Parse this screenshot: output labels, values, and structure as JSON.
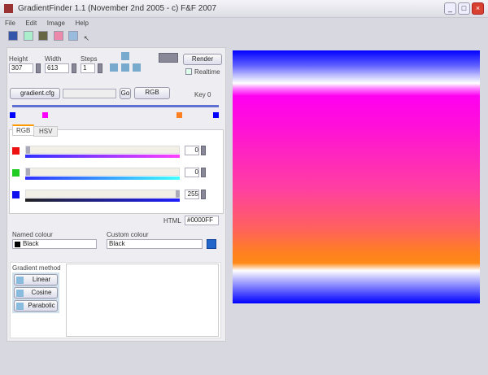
{
  "window": {
    "title": "GradientFinder 1.1 (November 2nd 2005 - c) F&F 2007",
    "minimize": "_",
    "maximize": "□",
    "close": "×"
  },
  "menu": [
    "File",
    "Edit",
    "Image",
    "Help"
  ],
  "toolbar": [
    "save-icon",
    "image-icon",
    "palette-icon",
    "paint-icon",
    "window-icon",
    "pointer-icon"
  ],
  "size": {
    "height_label": "Height",
    "height": "307",
    "width_label": "Width",
    "width": "613",
    "steps_label": "Steps",
    "steps": "1"
  },
  "render_button": "Render",
  "realtime_label": "Realtime",
  "file": {
    "name": "gradient.cfg",
    "field": "",
    "go": "Go",
    "mode": "RGB",
    "key": "Key 0"
  },
  "keys": [
    {
      "color": "#0000ff",
      "pos": 0
    },
    {
      "color": "#ff00ff",
      "pos": 0.16
    },
    {
      "color": "#ff8020",
      "pos": 0.82
    },
    {
      "color": "#0000ff",
      "pos": 1
    }
  ],
  "tabs": [
    "RGB",
    "HSV"
  ],
  "channels": [
    {
      "color": "#ee1111",
      "value": "0",
      "grad": "linear-gradient(90deg,#3030ff,#ff40ff)",
      "level": 0
    },
    {
      "color": "#22cc22",
      "value": "0",
      "grad": "linear-gradient(90deg,#3030ff,#40ffff)",
      "level": 0
    },
    {
      "color": "#1010ee",
      "value": "255",
      "grad": "linear-gradient(90deg,#222,#2020ff)",
      "level": 1
    }
  ],
  "html": {
    "label": "HTML",
    "value": "#0000FF"
  },
  "named": {
    "label": "Named colour",
    "value": "Black"
  },
  "custom": {
    "label": "Custom colour",
    "value": "Black"
  },
  "method": {
    "label": "Gradient method",
    "options": [
      "Linear",
      "Cosine",
      "Parabolic"
    ]
  }
}
